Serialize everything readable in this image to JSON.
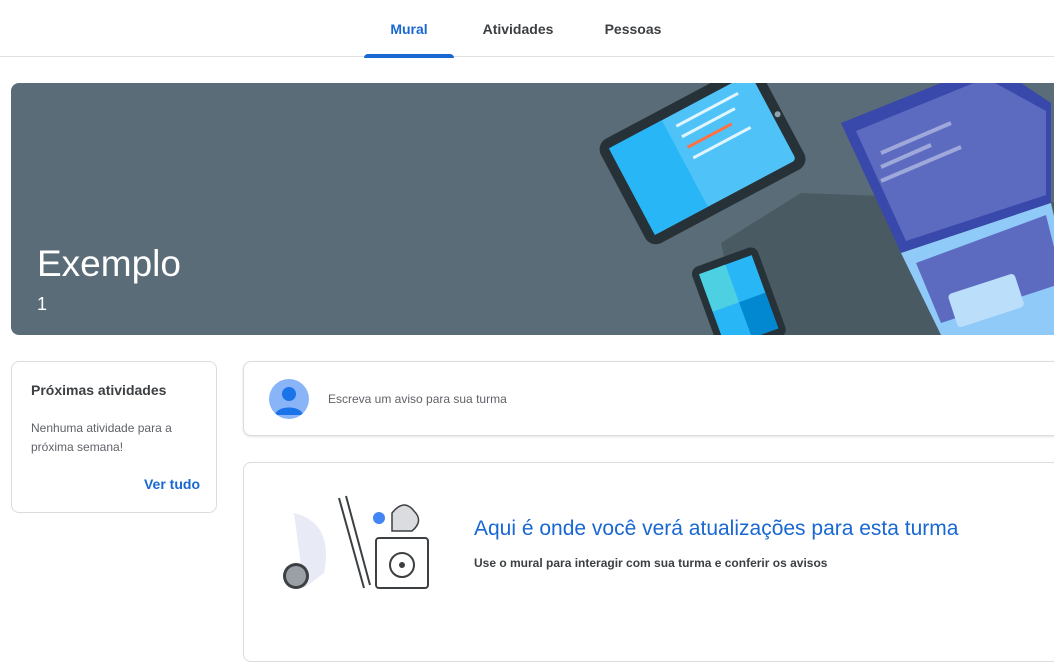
{
  "tabs": [
    {
      "label": "Mural",
      "active": true
    },
    {
      "label": "Atividades",
      "active": false
    },
    {
      "label": "Pessoas",
      "active": false
    }
  ],
  "banner": {
    "title": "Exemplo",
    "subtitle": "1",
    "color": "#5a6c77"
  },
  "upcoming": {
    "title": "Próximas atividades",
    "text": "Nenhuma atividade para a próxima semana!",
    "link": "Ver tudo"
  },
  "announce": {
    "placeholder": "Escreva um aviso para sua turma"
  },
  "stream": {
    "title": "Aqui é onde você verá atualizações para esta turma",
    "subtitle": "Use o mural para interagir com sua turma e conferir os avisos"
  },
  "colors": {
    "accent": "#1967d2",
    "avatar": "#8ab4f8"
  }
}
